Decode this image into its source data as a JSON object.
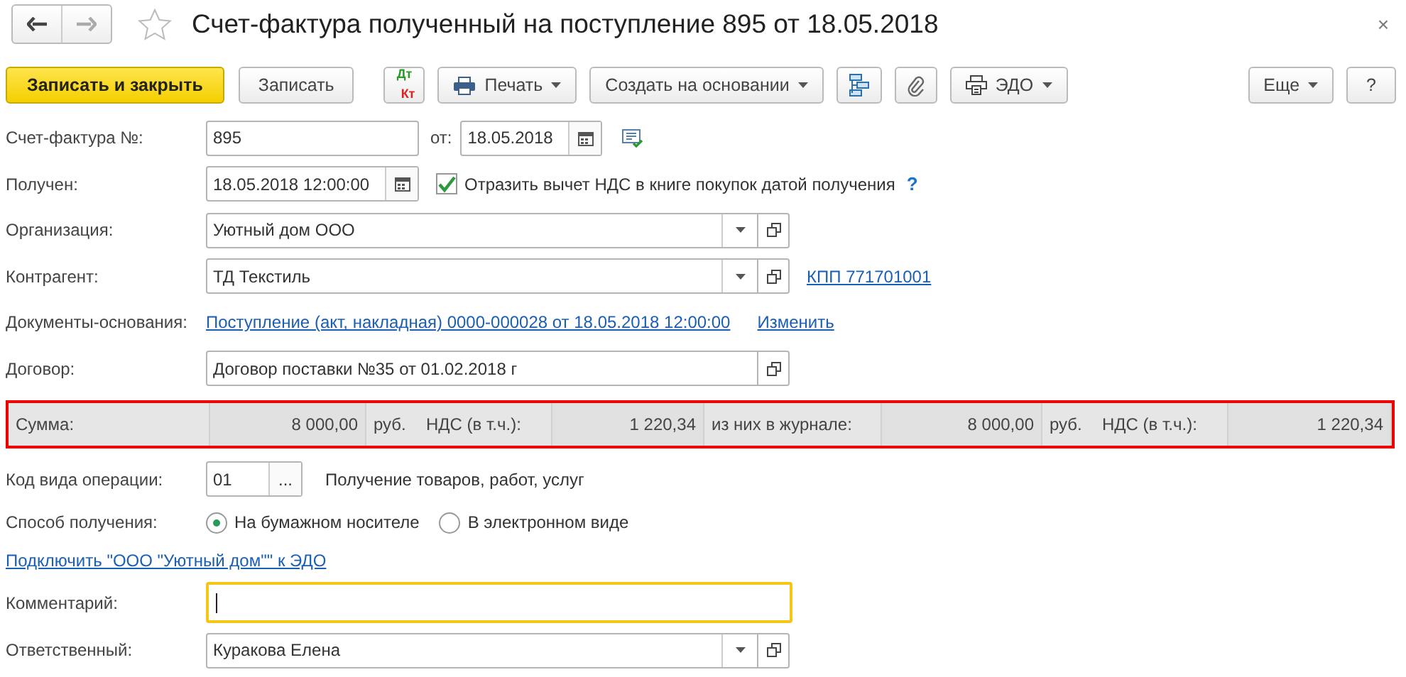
{
  "window": {
    "title": "Счет-фактура полученный на поступление 895 от 18.05.2018",
    "favorite": false,
    "close": "×"
  },
  "toolbar": [
    {
      "kind": "primary",
      "label": "Записать и закрыть"
    },
    {
      "kind": "plain",
      "label": "Записать"
    },
    {
      "kind": "dtkt",
      "top": "Дт",
      "bottom": "Кт"
    },
    {
      "kind": "print",
      "label": "Печать"
    },
    {
      "kind": "menu",
      "label": "Создать на основании"
    },
    {
      "kind": "structure"
    },
    {
      "kind": "attach"
    },
    {
      "kind": "edo",
      "label": "ЭДО"
    },
    {
      "kind": "spacer"
    },
    {
      "kind": "menu",
      "label": "Еще"
    },
    {
      "kind": "plain",
      "label": "?"
    }
  ],
  "invoice": {
    "label": "Счет-фактура №:",
    "number": "895",
    "date_label": "от:",
    "date": "18.05.2018"
  },
  "received": {
    "label": "Получен:",
    "datetime": "18.05.2018 12:00:00",
    "checkbox": {
      "label": "Отразить вычет НДС в книге покупок датой получения",
      "checked": true
    },
    "help": "?"
  },
  "organization": {
    "label": "Организация:",
    "value": "Уютный дом ООО"
  },
  "counterparty": {
    "label": "Контрагент:",
    "value": "ТД Текстиль",
    "link": "КПП 771701001"
  },
  "base_documents": {
    "label": "Документы-основания:",
    "link": "Поступление (акт, накладная) 0000-000028 от 18.05.2018 12:00:00",
    "change": "Изменить"
  },
  "contract": {
    "label": "Договор:",
    "value": "Договор поставки №35 от 01.02.2018 г"
  },
  "totals": [
    {
      "kind": "label",
      "text": "Сумма:"
    },
    {
      "kind": "value",
      "text": "8 000,00"
    },
    {
      "kind": "label",
      "text": "руб."
    },
    {
      "kind": "label",
      "text": "НДС (в т.ч.):"
    },
    {
      "kind": "value",
      "text": "1 220,34"
    },
    {
      "kind": "label",
      "text": "из них в журнале:"
    },
    {
      "kind": "value",
      "text": "8 000,00"
    },
    {
      "kind": "label",
      "text": "руб."
    },
    {
      "kind": "label",
      "text": "НДС (в т.ч.):"
    },
    {
      "kind": "value",
      "text": "1 220,34"
    }
  ],
  "operation_code": {
    "label": "Код вида операции:",
    "code": "01",
    "button": "...",
    "description": "Получение товаров, работ, услуг"
  },
  "receipt_method": {
    "label": "Способ получения:",
    "options": [
      {
        "label": "На бумажном носителе",
        "selected": true
      },
      {
        "label": "В электронном виде",
        "selected": false
      }
    ]
  },
  "connect_link": "Подключить \"ООО \"Уютный дом\"\" к ЭДО",
  "comment": {
    "label": "Комментарий:",
    "focused": true
  },
  "responsible": {
    "label": "Ответственный:",
    "value": "Куракова Елена"
  }
}
